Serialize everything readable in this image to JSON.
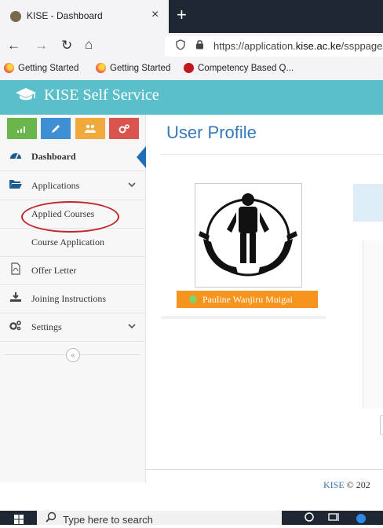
{
  "browser": {
    "tab_title": "KISE - Dashboard",
    "tab_close": "×",
    "new_tab": "+",
    "back": "←",
    "forward": "→",
    "reload": "↻",
    "home": "⌂",
    "url_prefix": "https://application.",
    "url_domain": "kise.ac.ke",
    "url_suffix": "/ssppages/",
    "bookmarks": [
      "Getting Started",
      "Getting Started",
      "Competency Based Q..."
    ]
  },
  "app": {
    "title": "KISE Self Service",
    "header_color": "#5bbfc9"
  },
  "quick_buttons": [
    {
      "icon": "bar-chart-icon",
      "color": "#6ab54c"
    },
    {
      "icon": "pencil-icon",
      "color": "#3e90d2"
    },
    {
      "icon": "users-icon",
      "color": "#f2a93b"
    },
    {
      "icon": "cogs-icon",
      "color": "#d9534f"
    }
  ],
  "sidebar": {
    "dashboard": "Dashboard",
    "applications": "Applications",
    "applied_courses": "Applied Courses",
    "course_application": "Course Application",
    "offer_letter": "Offer Letter",
    "joining_instructions": "Joining Instructions",
    "settings": "Settings",
    "collapse": "«"
  },
  "main": {
    "page_title": "User Profile",
    "user_name": "Pauline Wanjiru Muigai",
    "badge_color": "#f7941d"
  },
  "footer": {
    "brand": "KISE",
    "text": " © 202"
  },
  "taskbar": {
    "search_placeholder": "Type here to search"
  }
}
